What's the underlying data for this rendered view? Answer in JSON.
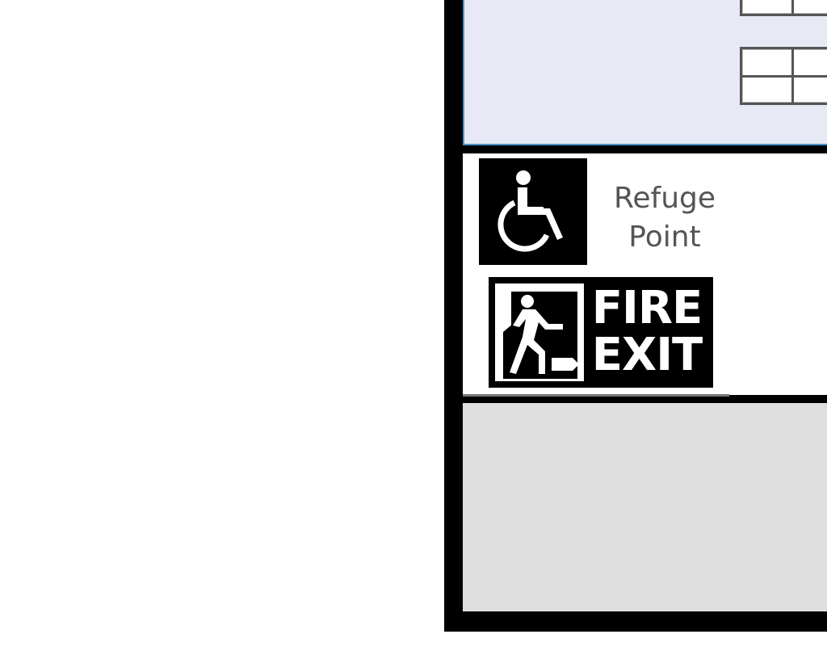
{
  "colors": {
    "wall": "#000000",
    "upper_room_fill": "#e7e9f4",
    "upper_room_edge": "#4a90c8",
    "corridor_fill": "#ffffff",
    "lower_room_fill": "#dedede",
    "label_text": "#555555"
  },
  "icons": {
    "refuge": "wheelchair-icon",
    "exit": "running-man-exit-icon",
    "windows": "window-icon"
  },
  "labels": {
    "refuge_line1": "Refuge",
    "refuge_line2": "Point",
    "fire_exit_line1": "FIRE",
    "fire_exit_line2": "EXIT"
  }
}
